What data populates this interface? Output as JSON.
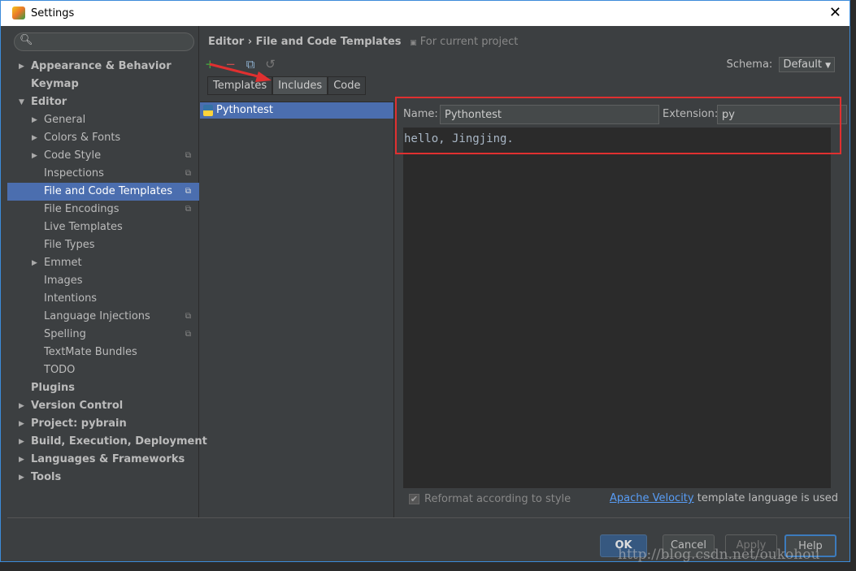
{
  "window": {
    "title": "Settings"
  },
  "search": {
    "placeholder": ""
  },
  "tree": [
    {
      "label": "Appearance & Behavior",
      "level": 0,
      "bold": true,
      "arrow": "right"
    },
    {
      "label": "Keymap",
      "level": 0,
      "bold": true
    },
    {
      "label": "Editor",
      "level": 0,
      "bold": true,
      "arrow": "down"
    },
    {
      "label": "General",
      "level": 1,
      "arrow": "right"
    },
    {
      "label": "Colors & Fonts",
      "level": 1,
      "arrow": "right"
    },
    {
      "label": "Code Style",
      "level": 1,
      "arrow": "right",
      "copy": true
    },
    {
      "label": "Inspections",
      "level": 1,
      "copy": true
    },
    {
      "label": "File and Code Templates",
      "level": 1,
      "copy": true,
      "selected": true
    },
    {
      "label": "File Encodings",
      "level": 1,
      "copy": true
    },
    {
      "label": "Live Templates",
      "level": 1
    },
    {
      "label": "File Types",
      "level": 1
    },
    {
      "label": "Emmet",
      "level": 1,
      "arrow": "right"
    },
    {
      "label": "Images",
      "level": 1
    },
    {
      "label": "Intentions",
      "level": 1
    },
    {
      "label": "Language Injections",
      "level": 1,
      "copy": true
    },
    {
      "label": "Spelling",
      "level": 1,
      "copy": true
    },
    {
      "label": "TextMate Bundles",
      "level": 1
    },
    {
      "label": "TODO",
      "level": 1
    },
    {
      "label": "Plugins",
      "level": 0,
      "bold": true
    },
    {
      "label": "Version Control",
      "level": 0,
      "bold": true,
      "arrow": "right"
    },
    {
      "label": "Project: pybrain",
      "level": 0,
      "bold": true,
      "arrow": "right"
    },
    {
      "label": "Build, Execution, Deployment",
      "level": 0,
      "bold": true,
      "arrow": "right"
    },
    {
      "label": "Languages & Frameworks",
      "level": 0,
      "bold": true,
      "arrow": "right"
    },
    {
      "label": "Tools",
      "level": 0,
      "bold": true,
      "arrow": "right"
    }
  ],
  "header": {
    "crumb1": "Editor",
    "sep": "›",
    "crumb2": "File and Code Templates",
    "scope": "For current project"
  },
  "schema": {
    "label": "Schema:",
    "value": "Default"
  },
  "tabs": [
    {
      "label": "Templates"
    },
    {
      "label": "Includes",
      "active": true
    },
    {
      "label": "Code"
    }
  ],
  "list": [
    {
      "label": "Pythontest"
    }
  ],
  "form": {
    "name_label": "Name:",
    "name_value": "Pythontest",
    "ext_label": "Extension:",
    "ext_value": "py"
  },
  "editor": {
    "content": "hello, Jingjing."
  },
  "options": {
    "reformat_label": "Reformat according to style",
    "reformat_checked": true,
    "link": "Apache Velocity",
    "link_suffix": " template language is used"
  },
  "buttons": {
    "ok": "OK",
    "cancel": "Cancel",
    "apply": "Apply",
    "help": "Help"
  },
  "watermark": "http://blog.csdn.net/oukohou",
  "colors": {
    "selection": "#4b6eaf",
    "annotation": "#e03030",
    "link": "#589df6"
  }
}
